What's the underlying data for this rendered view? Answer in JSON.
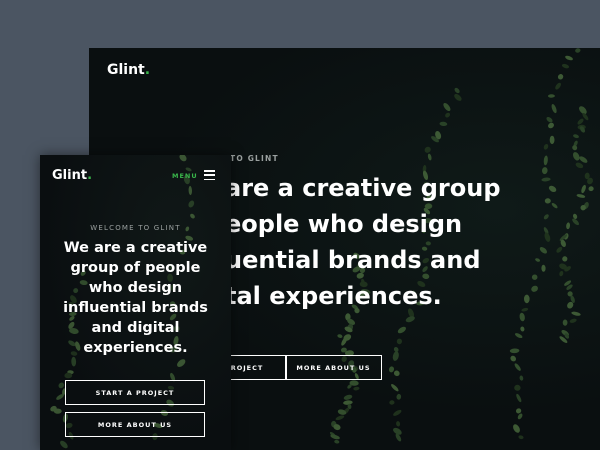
{
  "desktop": {
    "logo": "Glint",
    "logo_dot": ".",
    "kicker": "TO GLINT",
    "headline_lines": [
      "are a creative group",
      "eople who design",
      "uential brands and",
      "tal experiences."
    ],
    "start_button": "ROJECT",
    "more_button": "MORE ABOUT US"
  },
  "mobile": {
    "logo": "Glint",
    "logo_dot": ".",
    "menu_label": "MENU",
    "kicker": "WELCOME TO GLINT",
    "headline_lines": [
      "We are a creative",
      "group of people",
      "who design",
      "influential brands",
      "and digital",
      "experiences."
    ],
    "start_button": "START A PROJECT",
    "more_button": "MORE ABOUT US"
  },
  "colors": {
    "accent": "#39b54a",
    "page_background": "#4b5562",
    "hero_background": "#0b0f10",
    "text": "#ffffff"
  },
  "icons": [
    "hamburger-menu-icon"
  ]
}
